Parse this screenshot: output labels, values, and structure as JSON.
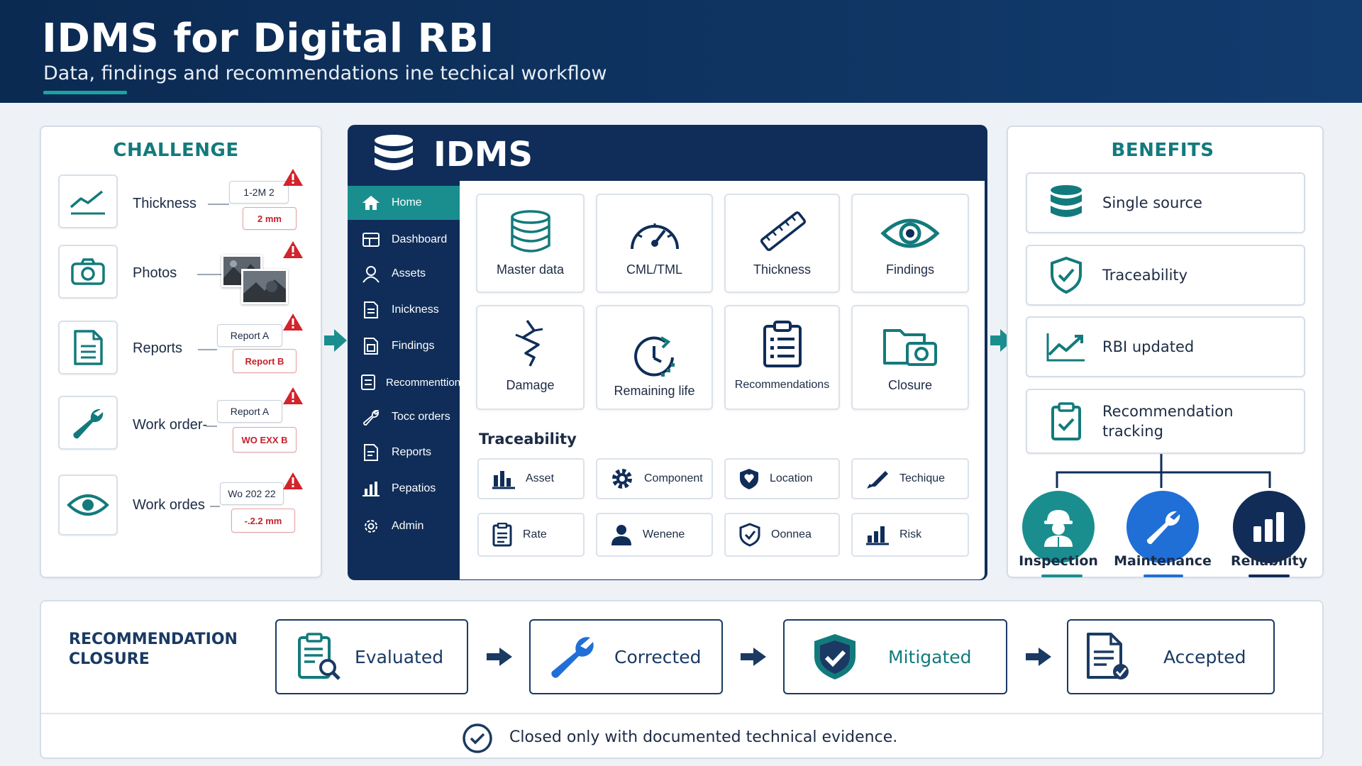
{
  "header": {
    "title": "IDMS for Digital RBI",
    "subtitle": "Data, findings and recommendations  ine techical workflow"
  },
  "challenge": {
    "title": "CHALLENGE",
    "rows": [
      {
        "icon": "chart-line-icon",
        "label": "Thickness",
        "box1": "1-2M 2",
        "box2": "2  mm"
      },
      {
        "icon": "camera-icon",
        "label": "Photos"
      },
      {
        "icon": "document-icon",
        "label": "Reports",
        "box1": "Report A",
        "box2": "Report B"
      },
      {
        "icon": "wrench-icon",
        "label": "Work order-",
        "box1": "Report A",
        "box2": "WO EXX B"
      },
      {
        "icon": "eye-icon",
        "label": "Work ordes",
        "box1": "Wo 202 22",
        "box2": "-.2.2 mm"
      }
    ]
  },
  "idms": {
    "title": "IDMS",
    "nav": [
      {
        "label": "Home",
        "icon": "home-icon",
        "active": true
      },
      {
        "label": "Dashboard",
        "icon": "dashboard-icon"
      },
      {
        "label": "Assets",
        "icon": "user-icon"
      },
      {
        "label": "Inickness",
        "icon": "document-icon"
      },
      {
        "label": "Findings",
        "icon": "document-icon"
      },
      {
        "label": "Recommenttion",
        "icon": "list-icon"
      },
      {
        "label": "Tocc orders",
        "icon": "wrench-icon"
      },
      {
        "label": "Reports",
        "icon": "document-icon"
      },
      {
        "label": "Pepatios",
        "icon": "bar-chart-icon"
      },
      {
        "label": "Admin",
        "icon": "gear-icon"
      }
    ],
    "tiles_row1": [
      "Master data",
      "CML/TML",
      "Thickness",
      "Findings"
    ],
    "tiles_row2": [
      "Damage",
      "Remaining life",
      "Recommendations",
      "Closure"
    ],
    "traceability_title": "Traceability",
    "trace_row1": [
      "Asset",
      "Component",
      "Location",
      "Techique"
    ],
    "trace_row2": [
      "Rate",
      "Wenene",
      "Oonnea",
      "Risk"
    ]
  },
  "benefits": {
    "title": "BENEFITS",
    "items": [
      "Single source",
      "Traceability",
      "RBI updated",
      "Recommendation tracking"
    ],
    "circles": [
      {
        "label": "Inspection",
        "color": "#1a8e8f"
      },
      {
        "label": "Maintenance",
        "color": "#1f6fd6"
      },
      {
        "label": "Reliability",
        "color": "#112c57"
      }
    ]
  },
  "closure": {
    "title_line1": "RECOMMENDATION",
    "title_line2": "CLOSURE",
    "steps": [
      "Evaluated",
      "Corrected",
      "Mitigated",
      "Accepted"
    ],
    "footer": "Closed only with documented technical evidence."
  },
  "colors": {
    "navy": "#0f2d58",
    "teal": "#1a8e8f",
    "blue": "#1f6fd6",
    "alert": "#d3232c"
  }
}
